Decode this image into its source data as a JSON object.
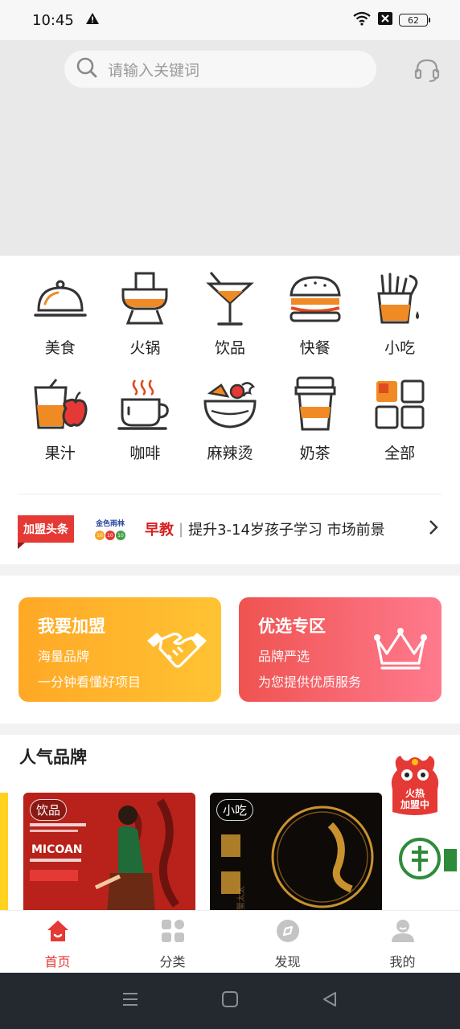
{
  "status": {
    "time": "10:45",
    "battery": "62"
  },
  "search": {
    "placeholder": "请输入关键词"
  },
  "categories": [
    {
      "label": "美食",
      "icon": "food-cloche-icon"
    },
    {
      "label": "火锅",
      "icon": "hotpot-icon"
    },
    {
      "label": "饮品",
      "icon": "cocktail-icon"
    },
    {
      "label": "快餐",
      "icon": "burger-icon"
    },
    {
      "label": "小吃",
      "icon": "fries-icon"
    },
    {
      "label": "果汁",
      "icon": "juice-icon"
    },
    {
      "label": "咖啡",
      "icon": "coffee-cup-icon"
    },
    {
      "label": "麻辣烫",
      "icon": "spicy-bowl-icon"
    },
    {
      "label": "奶茶",
      "icon": "milk-tea-icon"
    },
    {
      "label": "全部",
      "icon": "grid-all-icon"
    }
  ],
  "headline": {
    "badge": "加盟头条",
    "brand_logo_text": "金色雨林",
    "brand_logo_dots": [
      "10",
      "10",
      "10"
    ],
    "tag": "早教",
    "separator": "|",
    "text": "提升3-14岁孩子学习 市场前景"
  },
  "promo": {
    "join": {
      "title": "我要加盟",
      "line1": "海量品牌",
      "line2": "一分钟看懂好项目"
    },
    "select": {
      "title": "优选专区",
      "line1": "品牌严选",
      "line2": "为您提供优质服务"
    }
  },
  "popular": {
    "title": "人气品牌",
    "brands": [
      {
        "tag": "饮品",
        "name": "MICOAN"
      },
      {
        "tag": "小吃",
        "name": "蟹太太"
      }
    ],
    "hot_badge": "火热\n加盟中"
  },
  "tabs": [
    {
      "label": "首页",
      "active": true
    },
    {
      "label": "分类",
      "active": false
    },
    {
      "label": "发现",
      "active": false
    },
    {
      "label": "我的",
      "active": false
    }
  ],
  "colors": {
    "accent": "#e53935",
    "orange": "#ffb02e",
    "icon_orange": "#f08a24"
  }
}
